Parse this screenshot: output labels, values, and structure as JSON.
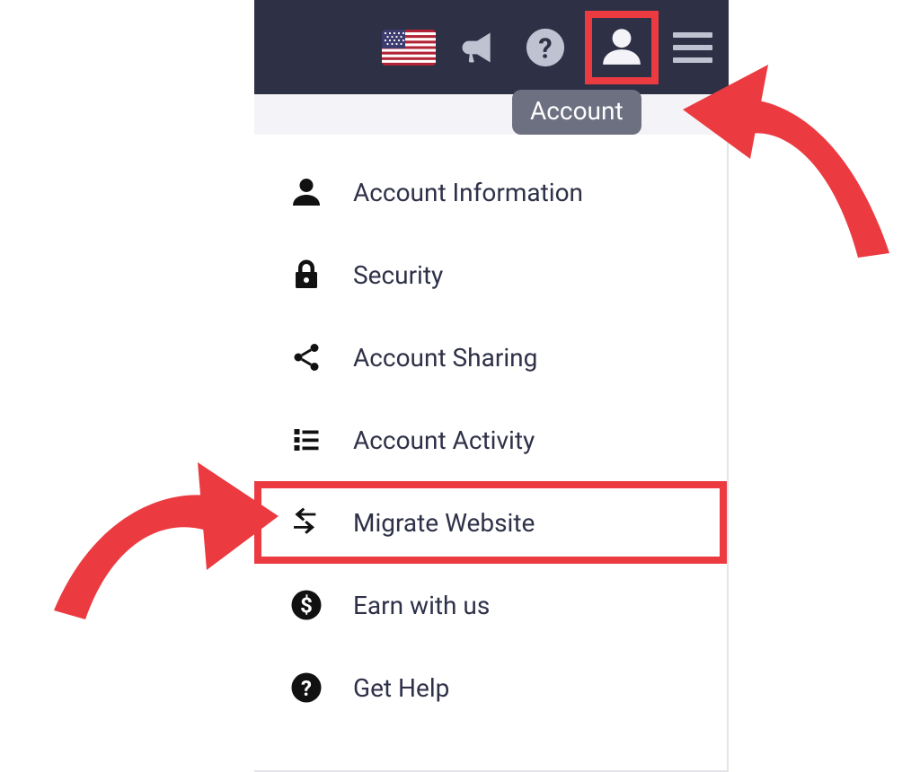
{
  "header": {
    "tooltip_label": "Account",
    "icons": {
      "flag": "flag-usa-icon",
      "megaphone": "megaphone-icon",
      "help": "help-icon",
      "account": "account-icon",
      "menu": "hamburger-icon"
    }
  },
  "menu": {
    "items": [
      {
        "icon": "person-icon",
        "label": "Account Information"
      },
      {
        "icon": "lock-icon",
        "label": "Security"
      },
      {
        "icon": "share-icon",
        "label": "Account Sharing"
      },
      {
        "icon": "list-icon",
        "label": "Account Activity"
      },
      {
        "icon": "swap-arrows-icon",
        "label": "Migrate Website",
        "highlighted": true
      },
      {
        "icon": "dollar-circle-icon",
        "label": "Earn with us"
      },
      {
        "icon": "help-circle-icon",
        "label": "Get Help"
      }
    ]
  },
  "annotation": {
    "highlight_color": "#eb3b41"
  }
}
